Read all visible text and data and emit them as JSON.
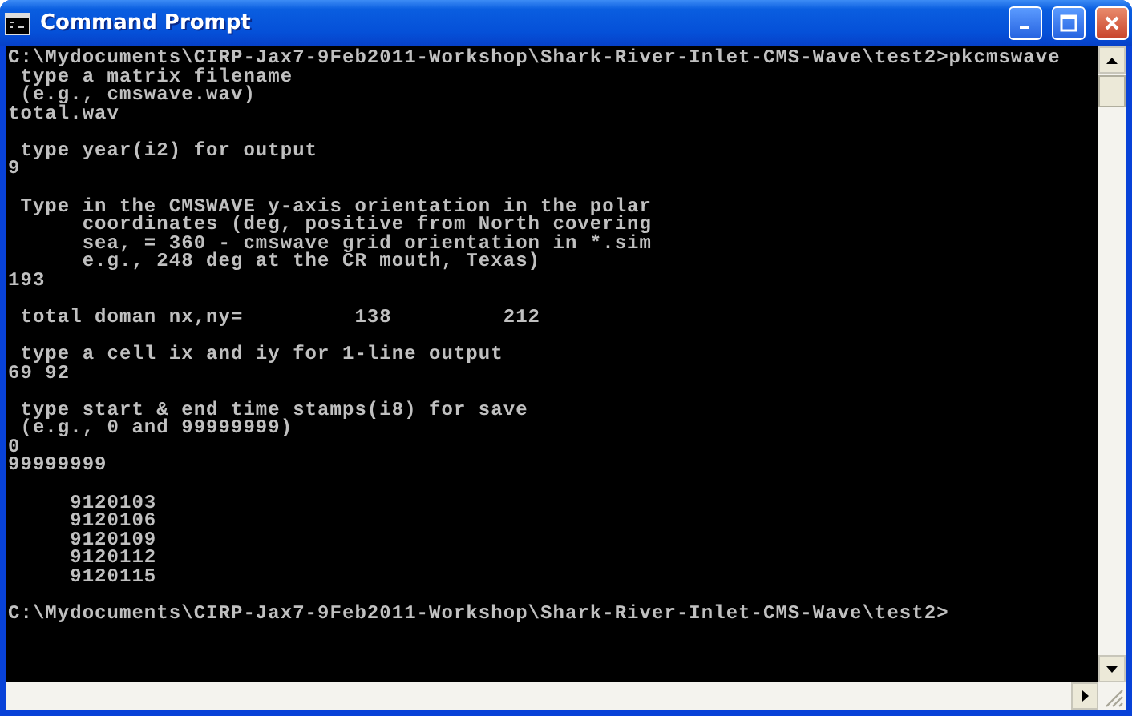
{
  "window": {
    "title": "Command Prompt",
    "buttons": [
      {
        "kind": "minimize"
      },
      {
        "kind": "maximize"
      },
      {
        "kind": "close"
      }
    ]
  },
  "console": {
    "blocks": [
      [
        "C:\\Mydocuments\\CIRP-Jax7-9Feb2011-Workshop\\Shark-River-Inlet-CMS-Wave\\test2>pkcmswave",
        " type a matrix filename",
        " (e.g., cmswave.wav)",
        "total.wav"
      ],
      [
        " type year(i2) for output",
        "9"
      ],
      [
        " Type in the CMSWAVE y-axis orientation in the polar",
        "      coordinates (deg, positive from North covering",
        "      sea, = 360 - cmswave grid orientation in *.sim",
        "      e.g., 248 deg at the CR mouth, Texas)",
        "193"
      ],
      [
        " total doman nx,ny=         138         212"
      ],
      [
        " type a cell ix and iy for 1-line output",
        "69 92"
      ],
      [
        " type start & end time stamps(i8) for save",
        " (e.g., 0 and 99999999)",
        "0",
        "99999999"
      ],
      [
        "     9120103",
        "     9120106",
        "     9120109",
        "     9120112",
        "     9120115"
      ],
      [
        "C:\\Mydocuments\\CIRP-Jax7-9Feb2011-Workshop\\Shark-River-Inlet-CMS-Wave\\test2>"
      ]
    ]
  }
}
